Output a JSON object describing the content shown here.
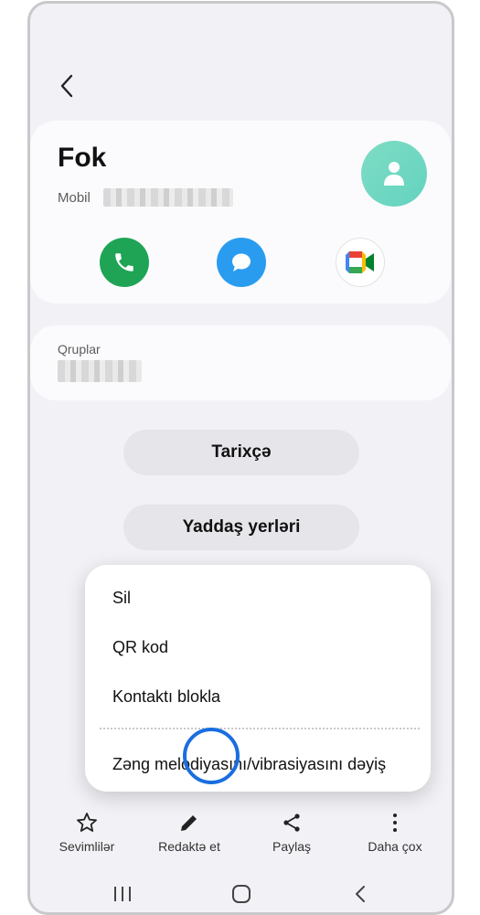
{
  "contact": {
    "name": "Fok",
    "phone_label": "Mobil"
  },
  "groups": {
    "label": "Qruplar"
  },
  "buttons": {
    "history": "Tarixçə",
    "storage": "Yaddaş yerləri"
  },
  "menu": {
    "items": [
      "Sil",
      "QR kod",
      "Kontaktı blokla",
      "Zəng melodiyasını/vibrasiyasını dəyiş"
    ]
  },
  "bottom_bar": {
    "items": [
      {
        "label": "Sevimlilər",
        "icon": "star-icon"
      },
      {
        "label": "Redaktə et",
        "icon": "pencil-icon"
      },
      {
        "label": "Paylaş",
        "icon": "share-icon"
      },
      {
        "label": "Daha çox",
        "icon": "more-vertical-icon"
      }
    ]
  },
  "colors": {
    "call": "#1fa456",
    "message": "#2a9cf0",
    "avatar": "#6fd8c2",
    "highlight": "#1a6ee0"
  }
}
